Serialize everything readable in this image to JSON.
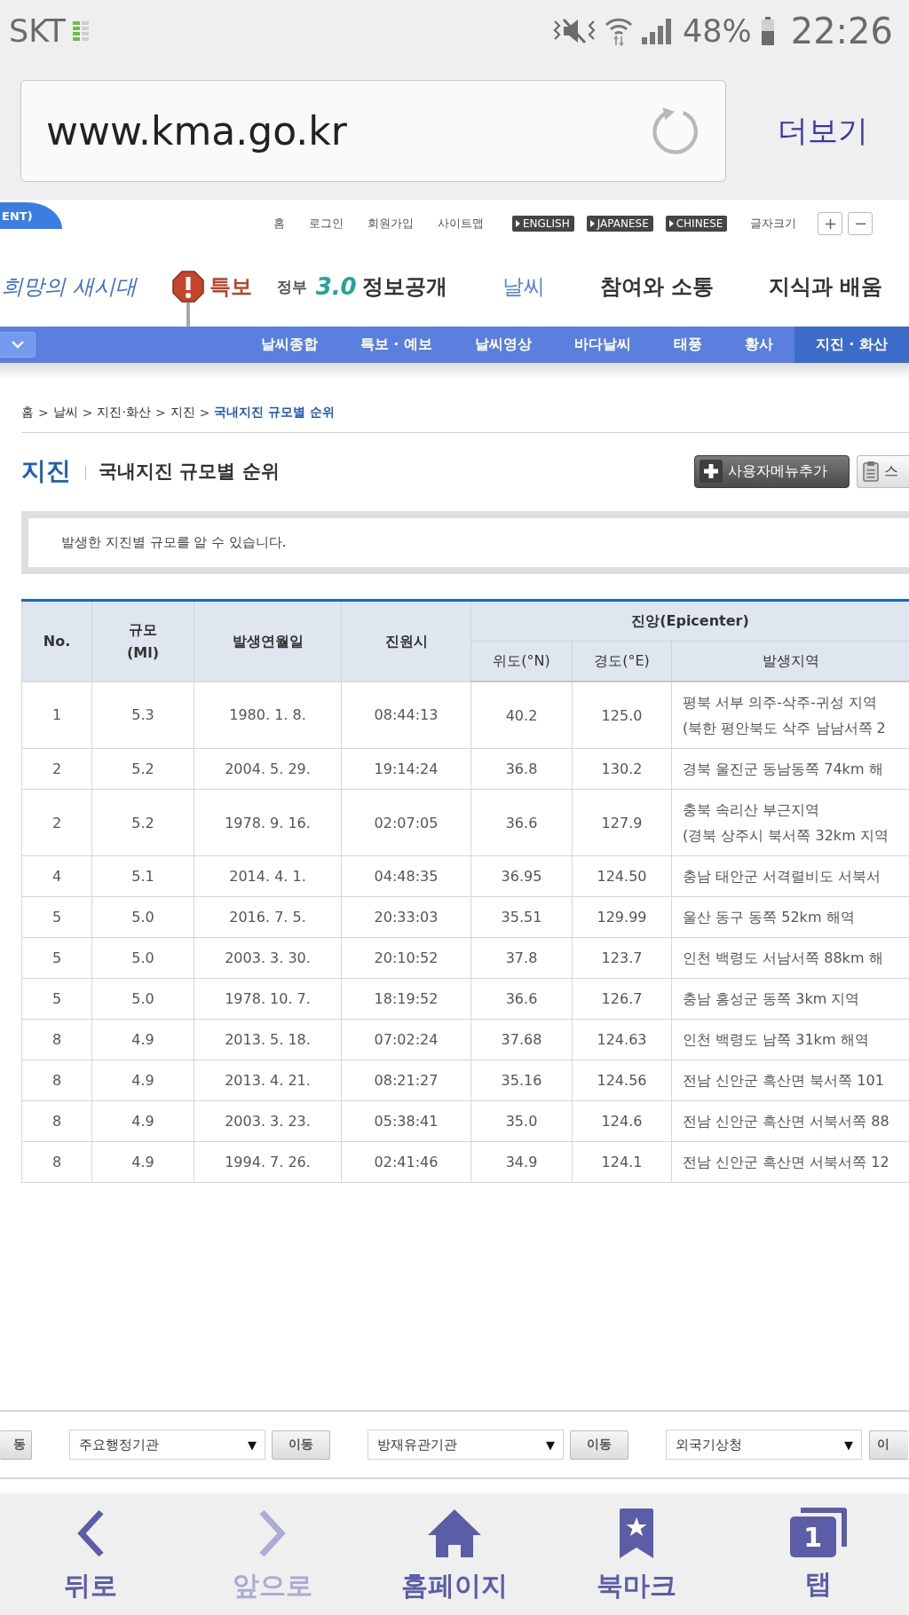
{
  "status_bar": {
    "carrier": "SKT",
    "battery": "48%",
    "time": "22:26"
  },
  "address_bar": {
    "url": "www.kma.go.kr",
    "menu": "더보기"
  },
  "utility_bar": {
    "banner_tab": "ENT)",
    "links": [
      "홈",
      "로그인",
      "회원가입",
      "사이트맵"
    ],
    "languages": [
      "ENGLISH",
      "JAPANESE",
      "CHINESE"
    ],
    "font_size": {
      "label": "글자크기",
      "buttons": [
        "+",
        "−"
      ]
    }
  },
  "header": {
    "slogan": "희망의 새시대",
    "alert": "특보",
    "gov": {
      "prefix": "정부",
      "version": "3.0",
      "label": "정보공개"
    },
    "nav": [
      {
        "label": "날씨",
        "selected": true
      },
      {
        "label": "참여와 소통",
        "selected": false
      },
      {
        "label": "지식과 배움",
        "selected": false
      }
    ]
  },
  "sub_nav": {
    "items": [
      {
        "label": "날씨종합",
        "selected": false
      },
      {
        "label": "특보 · 예보",
        "selected": false
      },
      {
        "label": "날씨영상",
        "selected": false
      },
      {
        "label": "바다날씨",
        "selected": false
      },
      {
        "label": "태풍",
        "selected": false
      },
      {
        "label": "황사",
        "selected": false
      },
      {
        "label": "지진 · 화산",
        "selected": true
      }
    ]
  },
  "breadcrumb": {
    "separator": ">",
    "items": [
      {
        "label": "홈",
        "current": false
      },
      {
        "label": "날씨",
        "current": false
      },
      {
        "label": "지진·화산",
        "current": false
      },
      {
        "label": "지진",
        "current": false
      },
      {
        "label": "국내지진 규모별 순위",
        "current": true
      }
    ]
  },
  "page_title": {
    "section": "지진",
    "title": "국내지진 규모별 순위"
  },
  "actions": [
    {
      "kind": "add",
      "label": "사용자메뉴추가"
    },
    {
      "kind": "clipboard",
      "label": "스"
    }
  ],
  "notice": "발생한 지진별 규모를 알 수 있습니다.",
  "table": {
    "columns": [
      {
        "lines": [
          "No."
        ]
      },
      {
        "lines": [
          "규모",
          "(Ml)"
        ]
      },
      {
        "lines": [
          "발생연월일"
        ]
      },
      {
        "lines": [
          "진원시"
        ]
      }
    ],
    "group": {
      "label": "진앙(Epicenter)",
      "columns": [
        "위도(°N)",
        "경도(°E)",
        "발생지역"
      ]
    },
    "rows": [
      {
        "rank": "1",
        "magnitude": "5.3",
        "date": "1980. 1. 8.",
        "time": "08:44:13",
        "lat": "40.2",
        "lon": "125.0",
        "region": [
          "평북 서부 의주-삭주-귀성 지역",
          "(북한 평안북도 삭주 남남서쪽 2"
        ]
      },
      {
        "rank": "2",
        "magnitude": "5.2",
        "date": "2004. 5. 29.",
        "time": "19:14:24",
        "lat": "36.8",
        "lon": "130.2",
        "region": [
          "경북 울진군 동남동쪽 74km 해"
        ]
      },
      {
        "rank": "2",
        "magnitude": "5.2",
        "date": "1978. 9. 16.",
        "time": "02:07:05",
        "lat": "36.6",
        "lon": "127.9",
        "region": [
          "충북 속리산 부근지역",
          "(경북 상주시 북서쪽 32km 지역"
        ]
      },
      {
        "rank": "4",
        "magnitude": "5.1",
        "date": "2014. 4. 1.",
        "time": "04:48:35",
        "lat": "36.95",
        "lon": "124.50",
        "region": [
          "충남 태안군 서격렬비도 서북서"
        ]
      },
      {
        "rank": "5",
        "magnitude": "5.0",
        "date": "2016. 7. 5.",
        "time": "20:33:03",
        "lat": "35.51",
        "lon": "129.99",
        "region": [
          "울산 동구 동쪽 52km 해역"
        ]
      },
      {
        "rank": "5",
        "magnitude": "5.0",
        "date": "2003. 3. 30.",
        "time": "20:10:52",
        "lat": "37.8",
        "lon": "123.7",
        "region": [
          "인천 백령도 서남서쪽 88km 해"
        ]
      },
      {
        "rank": "5",
        "magnitude": "5.0",
        "date": "1978. 10. 7.",
        "time": "18:19:52",
        "lat": "36.6",
        "lon": "126.7",
        "region": [
          "충남 홍성군 동쪽 3km 지역"
        ]
      },
      {
        "rank": "8",
        "magnitude": "4.9",
        "date": "2013. 5. 18.",
        "time": "07:02:24",
        "lat": "37.68",
        "lon": "124.63",
        "region": [
          "인천 백령도 남쪽 31km 해역"
        ]
      },
      {
        "rank": "8",
        "magnitude": "4.9",
        "date": "2013. 4. 21.",
        "time": "08:21:27",
        "lat": "35.16",
        "lon": "124.56",
        "region": [
          "전남 신안군 흑산면 북서쪽 101"
        ]
      },
      {
        "rank": "8",
        "magnitude": "4.9",
        "date": "2003. 3. 23.",
        "time": "05:38:41",
        "lat": "35.0",
        "lon": "124.6",
        "region": [
          "전남 신안군 흑산면 서북서쪽 88"
        ]
      },
      {
        "rank": "8",
        "magnitude": "4.9",
        "date": "1994. 7. 26.",
        "time": "02:41:46",
        "lat": "34.9",
        "lon": "124.1",
        "region": [
          "전남 신안군 흑산면 서북서쪽 12"
        ]
      }
    ]
  },
  "footer_links": {
    "leading_button": "동",
    "groups": [
      {
        "select": "주요행정기관",
        "arrow": "▼",
        "button": "이동"
      },
      {
        "select": "방재유관기관",
        "arrow": "▼",
        "button": "이동"
      },
      {
        "select": "외국기상청",
        "arrow": "▼",
        "button": "이"
      }
    ]
  },
  "browser_nav": [
    {
      "kind": "back",
      "label": "뒤로",
      "disabled": false
    },
    {
      "kind": "forward",
      "label": "앞으로",
      "disabled": true
    },
    {
      "kind": "home",
      "label": "홈페이지",
      "disabled": false
    },
    {
      "kind": "bookmark",
      "label": "북마크",
      "disabled": false
    },
    {
      "kind": "tabs",
      "label": "탭",
      "count": "1",
      "disabled": false
    }
  ]
}
